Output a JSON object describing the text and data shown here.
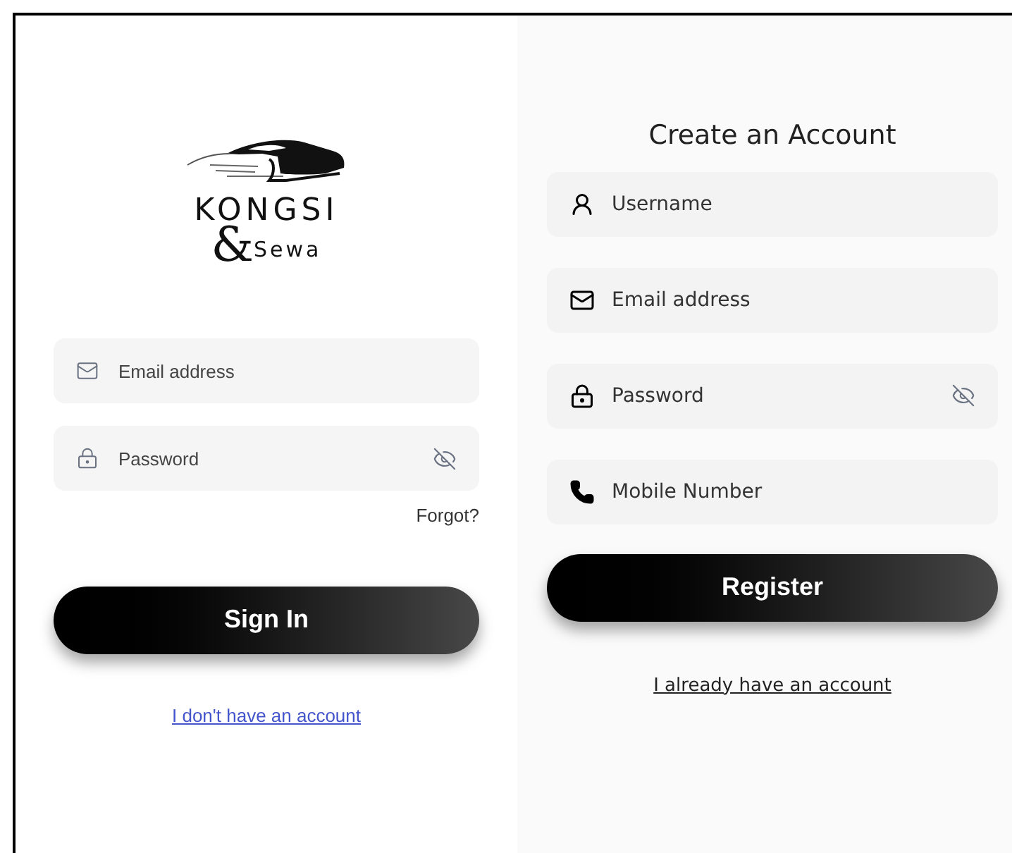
{
  "sign_in": {
    "logo": {
      "brand": "KONGSI",
      "ampersand": "&",
      "subtitle": "Sewa"
    },
    "fields": [
      {
        "kind": "email",
        "placeholder": "Email address"
      },
      {
        "kind": "password",
        "placeholder": "Password",
        "show_password": false
      }
    ],
    "forgot_link": "Forgot?",
    "button": "Sign In",
    "switch_link": "I don't have an account"
  },
  "register": {
    "title": "Create an Account",
    "fields": [
      {
        "kind": "user",
        "placeholder": "Username"
      },
      {
        "kind": "email",
        "placeholder": "Email address"
      },
      {
        "kind": "password",
        "placeholder": "Password",
        "show_password": false
      },
      {
        "kind": "phone",
        "placeholder": "Mobile Number"
      }
    ],
    "button": "Register",
    "switch_link": "I already have an account"
  }
}
